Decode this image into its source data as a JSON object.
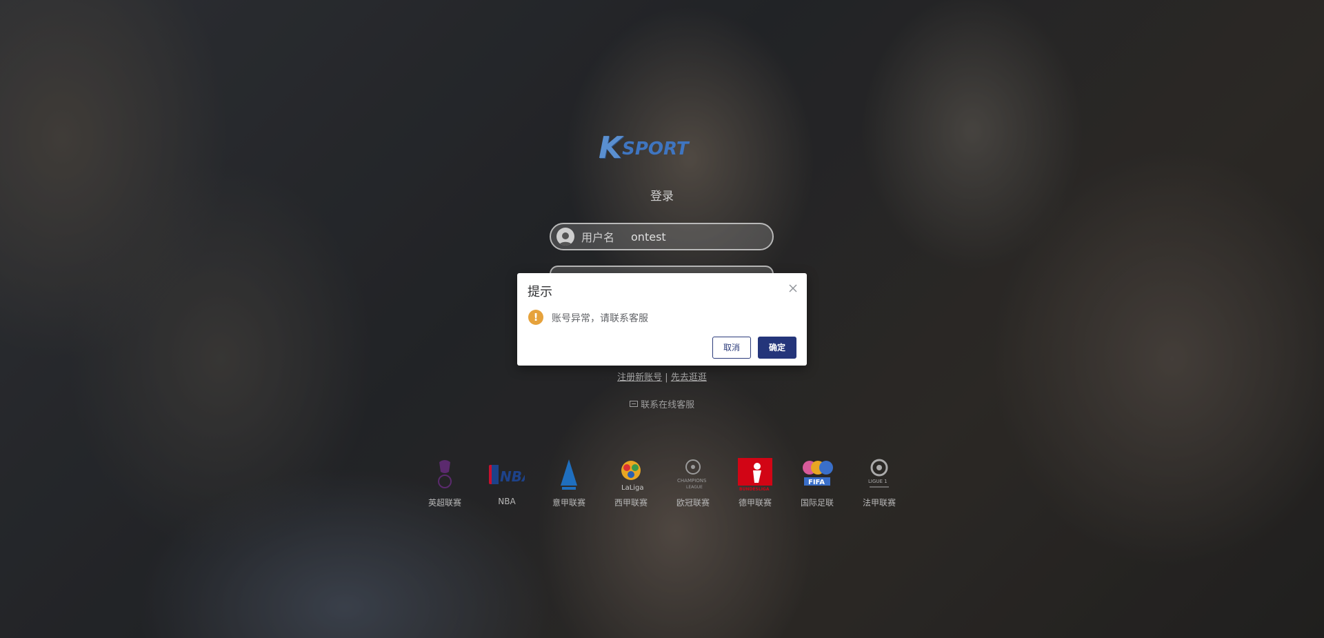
{
  "brand": {
    "logo_k": "K",
    "logo_sport": "SPORT"
  },
  "login": {
    "title": "登录",
    "username_label": "用户名",
    "username_value": "ontest"
  },
  "links": {
    "register": "注册新账号",
    "separator": "|",
    "browse": "先去逛逛"
  },
  "service": {
    "icon": "chat-icon",
    "label": "联系在线客服"
  },
  "leagues": [
    {
      "name": "英超联赛",
      "icon": "premier-league-icon",
      "color": "#5b2a6e"
    },
    {
      "name": "NBA",
      "icon": "nba-icon",
      "color": "#1d428a"
    },
    {
      "name": "意甲联赛",
      "icon": "serie-a-icon",
      "color": "#1f6fbf"
    },
    {
      "name": "西甲联赛",
      "icon": "laliga-icon",
      "color": "#e8a623"
    },
    {
      "name": "欧冠联赛",
      "icon": "champions-league-icon",
      "color": "#9a9a9a"
    },
    {
      "name": "德甲联赛",
      "icon": "bundesliga-icon",
      "color": "#d20515"
    },
    {
      "name": "国际足联",
      "icon": "fifa-icon",
      "color": "#3a6fc9"
    },
    {
      "name": "法甲联赛",
      "icon": "ligue1-icon",
      "color": "#aaaaaa"
    }
  ],
  "dialog": {
    "title": "提示",
    "message": "账号异常，请联系客服",
    "cancel": "取消",
    "confirm": "确定",
    "warning_color": "#e6a23c",
    "primary_color": "#24357a"
  }
}
